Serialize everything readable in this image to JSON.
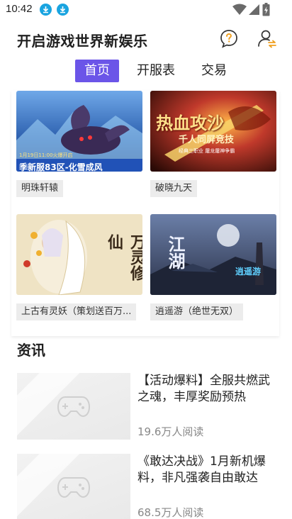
{
  "status_bar": {
    "time": "10:42",
    "icons": [
      "download-icon",
      "download-icon",
      "wifi-icon",
      "signal-icon",
      "battery-icon"
    ]
  },
  "header": {
    "title": "开启游戏世界新娱乐",
    "icons": [
      "help-chat-icon",
      "user-switch-icon"
    ]
  },
  "tabs": [
    {
      "label": "首页",
      "active": true
    },
    {
      "label": "开服表",
      "active": false
    },
    {
      "label": "交易",
      "active": false
    }
  ],
  "games": [
    {
      "name": "明珠轩辕",
      "cover_caption": "季新服83区-化雪成风",
      "cover_note": "1月19日11:00火爆开启"
    },
    {
      "name": "破晓九天",
      "cover_caption": "热血攻沙",
      "cover_sub": "千人同屏竞技",
      "cover_note": "经典三职业 屠龙屠神争霸"
    },
    {
      "name": "上古有灵妖（策划送百万...",
      "cover_caption": "万灵修仙"
    },
    {
      "name": "逍遥游（绝世无双）",
      "cover_caption": "江湖",
      "cover_sub": "逍遥游"
    }
  ],
  "news": {
    "heading": "资讯",
    "items": [
      {
        "title": "【活动爆料】全服共燃武之魂，丰厚奖励预热",
        "views": "19.6万人阅读"
      },
      {
        "title": "《敢达决战》1月新机爆料，非凡强袭自由敢达",
        "views": "68.5万人阅读"
      }
    ]
  },
  "colors": {
    "accent": "#6b55e8",
    "download": "#1aa4e0",
    "user_icon_accent": "#f0a020"
  }
}
